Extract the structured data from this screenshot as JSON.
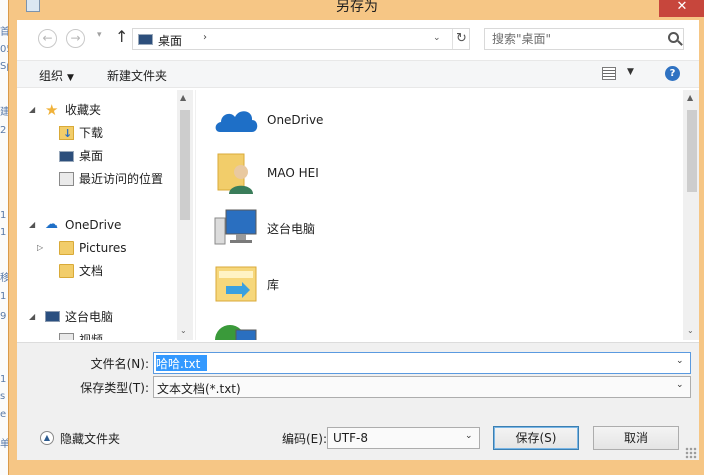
{
  "background_app": {
    "glyphs": [
      "首",
      "05",
      "Sp",
      "建",
      "2",
      "1",
      "1",
      "移",
      "1",
      "9",
      "1",
      "s",
      "e",
      "单"
    ]
  },
  "dialog": {
    "title": "另存为",
    "close_symbol": "✕"
  },
  "nav": {
    "back_symbol": "←",
    "forward_symbol": "→",
    "history_symbol": "▾",
    "up_symbol": "↑",
    "address": {
      "location": "桌面",
      "separator": "›",
      "dropdown_symbol": "⌄",
      "refresh_symbol": "↻"
    },
    "search": {
      "placeholder": "搜索\"桌面\""
    }
  },
  "toolbar": {
    "organize_label": "组织",
    "organize_caret": "▼",
    "new_folder_label": "新建文件夹",
    "views_caret": "▼",
    "help_symbol": "?"
  },
  "tree": {
    "items": [
      {
        "arrow": "◢",
        "icon": "star-icon",
        "label": "收藏夹"
      },
      {
        "arrow": "",
        "icon": "downloads-folder-icon",
        "label": "下载"
      },
      {
        "arrow": "",
        "icon": "desktop-icon",
        "label": "桌面"
      },
      {
        "arrow": "",
        "icon": "recent-places-icon",
        "label": "最近访问的位置"
      },
      {
        "arrow": "◢",
        "icon": "onedrive-cloud-icon",
        "label": "OneDrive"
      },
      {
        "arrow": "▷",
        "icon": "folder-icon",
        "label": "Pictures"
      },
      {
        "arrow": "",
        "icon": "folder-icon",
        "label": "文档"
      },
      {
        "arrow": "◢",
        "icon": "this-pc-icon",
        "label": "这台电脑"
      },
      {
        "arrow": "",
        "icon": "video-icon",
        "label": "视频"
      }
    ],
    "scroll_up": "▲",
    "scroll_down": "⌄"
  },
  "files": {
    "items": [
      {
        "icon": "onedrive-icon",
        "label": "OneDrive"
      },
      {
        "icon": "user-folder-icon",
        "label": "MAO HEI"
      },
      {
        "icon": "computer-icon",
        "label": "这台电脑"
      },
      {
        "icon": "library-icon",
        "label": "库"
      },
      {
        "icon": "network-icon",
        "label": ""
      }
    ],
    "scroll_up": "▲",
    "scroll_down": "⌄"
  },
  "form": {
    "filename_label": "文件名(N):",
    "filename_value": "哈哈.txt",
    "filetype_label": "保存类型(T):",
    "filetype_value": "文本文档(*.txt)",
    "dropdown_symbol": "⌄",
    "hide_folders_label": "隐藏文件夹",
    "hide_folders_symbol": "▲",
    "encoding_label": "编码(E):",
    "encoding_value": "UTF-8",
    "save_label": "保存(S)",
    "cancel_label": "取消"
  },
  "colors": {
    "frame": "#f6c685",
    "close": "#c7463c",
    "selection": "#3399ff",
    "onedrive": "#1e6fc7"
  }
}
